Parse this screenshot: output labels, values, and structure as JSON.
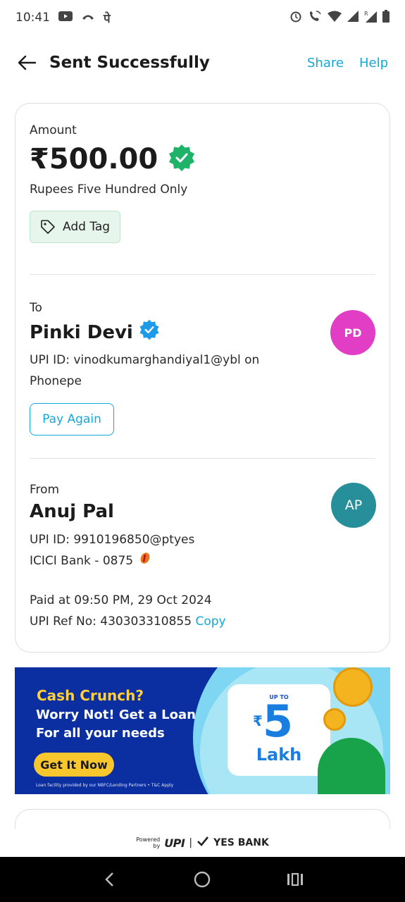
{
  "status_bar": {
    "time": "10:41",
    "icons_left": [
      "youtube-icon",
      "missed-call-icon",
      "app-pe-icon"
    ],
    "icons_right": [
      "alarm-icon",
      "wifi-call-icon",
      "wifi-icon",
      "signal-icon",
      "signal-roaming-icon",
      "battery-icon"
    ],
    "app_glyph": "पे"
  },
  "header": {
    "title": "Sent Successfully",
    "share_label": "Share",
    "help_label": "Help"
  },
  "amount_section": {
    "label": "Amount",
    "value": "₹500.00",
    "in_words": "Rupees Five Hundred Only",
    "tag_label": "Add Tag"
  },
  "to_section": {
    "label": "To",
    "name": "Pinki Devi",
    "upi_line1": "UPI ID: vinodkumarghandiyal1@ybl on",
    "upi_line2": "Phonepe",
    "avatar_initials": "PD",
    "pay_again_label": "Pay Again"
  },
  "from_section": {
    "label": "From",
    "name": "Anuj Pal",
    "upi_id": "UPI ID: 9910196850@ptyes",
    "bank": "ICICI Bank - 0875",
    "avatar_initials": "AP",
    "paid_at": "Paid at 09:50 PM, 29 Oct 2024",
    "ref_no": "UPI Ref No: 430303310855",
    "copy_label": "Copy"
  },
  "banner": {
    "title": "Cash Crunch?",
    "line1": "Worry Not! Get a Loan",
    "line2": "For all your needs",
    "cta": "Get It Now",
    "fine_print": "Loan facility provided by our NBFC/Lending Partners • T&C Apply",
    "upto": "UP TO",
    "rupee": "₹",
    "amount": "5",
    "unit": "Lakh"
  },
  "footer": {
    "powered_by": "Powered by",
    "upi": "UPI",
    "bank": "YES BANK"
  },
  "colors": {
    "accent": "#14a8d6",
    "verified_green": "#1fb36a",
    "verified_blue": "#1e9be8",
    "avatar_pd": "#e23ec5",
    "avatar_ap": "#268f9a",
    "banner_bg": "#0b2fa0",
    "banner_title": "#ffcf3a"
  },
  "nav": {
    "back_icon": "back-triangle-icon",
    "home_icon": "home-circle-icon",
    "recents_icon": "recents-icon"
  }
}
